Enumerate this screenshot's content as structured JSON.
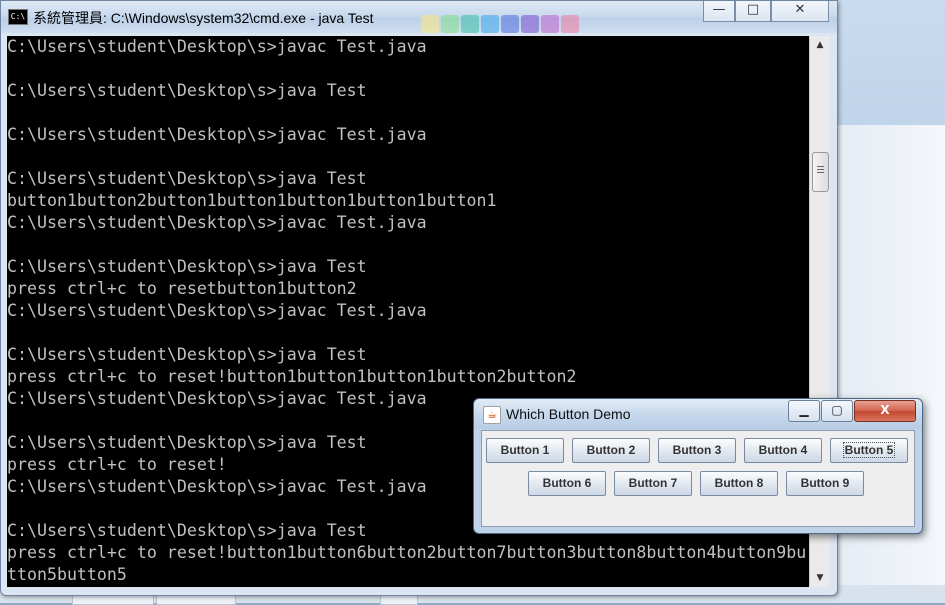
{
  "cmd_window": {
    "title": "系統管理員: C:\\Windows\\system32\\cmd.exe - java  Test",
    "icon_label": "C:\\",
    "controls": {
      "minimize": "—",
      "maximize": "□",
      "close": "✕"
    },
    "lines": [
      "C:\\Users\\student\\Desktop\\s>javac Test.java",
      "",
      "C:\\Users\\student\\Desktop\\s>java Test",
      "",
      "C:\\Users\\student\\Desktop\\s>javac Test.java",
      "",
      "C:\\Users\\student\\Desktop\\s>java Test",
      "button1button2button1button1button1button1button1",
      "C:\\Users\\student\\Desktop\\s>javac Test.java",
      "",
      "C:\\Users\\student\\Desktop\\s>java Test",
      "press ctrl+c to resetbutton1button2",
      "C:\\Users\\student\\Desktop\\s>javac Test.java",
      "",
      "C:\\Users\\student\\Desktop\\s>java Test",
      "press ctrl+c to reset!button1button1button1button2button2",
      "C:\\Users\\student\\Desktop\\s>javac Test.java",
      "",
      "C:\\Users\\student\\Desktop\\s>java Test",
      "press ctrl+c to reset!",
      "C:\\Users\\student\\Desktop\\s>javac Test.java",
      "",
      "C:\\Users\\student\\Desktop\\s>java Test",
      "press ctrl+c to reset!button1button6button2button7button3button8button4button9bu",
      "tton5button5"
    ],
    "scrollbar": {
      "up_arrow": "▲",
      "down_arrow": "▼"
    }
  },
  "java_window": {
    "title": "Which Button Demo",
    "controls": {
      "minimize": "▁",
      "maximize": "▢",
      "close": "X"
    },
    "buttons": [
      "Button 1",
      "Button 2",
      "Button 3",
      "Button 4",
      "Button 5",
      "Button 6",
      "Button 7",
      "Button 8",
      "Button 9"
    ],
    "focused_button": "Button 5"
  },
  "colors": {
    "console_bg": "#000000",
    "console_fg": "#c0c0c0",
    "close_button": "#c24a32"
  }
}
